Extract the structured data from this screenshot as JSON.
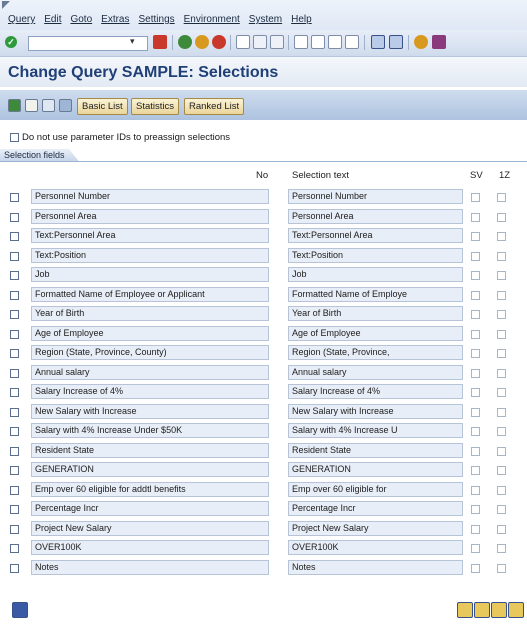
{
  "menu": [
    "Query",
    "Edit",
    "Goto",
    "Extras",
    "Settings",
    "Environment",
    "System",
    "Help"
  ],
  "window_title": "Change Query SAMPLE: Selections",
  "app_toolbar": {
    "basic_list": "Basic List",
    "statistics": "Statistics",
    "ranked_list": "Ranked List"
  },
  "option_label": "Do not use parameter IDs to preassign selections",
  "tab_label": "Selection fields",
  "columns": {
    "no": "No",
    "selection_text": "Selection text",
    "sv": "SV",
    "z1": "1Z"
  },
  "rows": [
    {
      "name": "Personnel Number",
      "text": "Personnel Number"
    },
    {
      "name": "Personnel Area",
      "text": "Personnel Area"
    },
    {
      "name": "Text:Personnel Area",
      "text": "Text:Personnel Area"
    },
    {
      "name": "Text:Position",
      "text": "Text:Position"
    },
    {
      "name": "Job",
      "text": "Job"
    },
    {
      "name": "Formatted Name of Employee or Applicant",
      "text": "Formatted Name of Employe"
    },
    {
      "name": "Year of Birth",
      "text": "Year of Birth"
    },
    {
      "name": "Age of Employee",
      "text": "Age of Employee"
    },
    {
      "name": "Region (State, Province, County)",
      "text": "Region (State, Province,"
    },
    {
      "name": "Annual salary",
      "text": "Annual salary"
    },
    {
      "name": "Salary Increase of 4%",
      "text": "Salary Increase of 4%"
    },
    {
      "name": "New Salary with Increase",
      "text": "New Salary with Increase"
    },
    {
      "name": "Salary with 4% Increase Under $50K",
      "text": "Salary with 4% Increase U"
    },
    {
      "name": "Resident State",
      "text": "Resident State"
    },
    {
      "name": "GENERATION",
      "text": "GENERATION"
    },
    {
      "name": "Emp over 60 eligible for addtl benefits",
      "text": "Emp over 60 eligible for"
    },
    {
      "name": "Percentage Incr",
      "text": "Percentage Incr"
    },
    {
      "name": "Project New Salary",
      "text": "Project New Salary"
    },
    {
      "name": "OVER100K",
      "text": "OVER100K"
    },
    {
      "name": "Notes",
      "text": "Notes"
    }
  ],
  "colors": {
    "title": "#1f3f76",
    "field_bg": "#e8eef7",
    "toolbar_button": "#ead59a",
    "ok_icon": "#2e9a3b"
  },
  "icons": {
    "toolbar": [
      "enter-icon",
      "save-icon",
      "back-icon",
      "exit-icon",
      "cancel-icon",
      "print-icon",
      "find-icon",
      "find-next-icon",
      "first-page-icon",
      "previous-page-icon",
      "next-page-icon",
      "last-page-icon",
      "create-session-icon",
      "shortcut-icon",
      "help-icon",
      "customize-layout-icon"
    ],
    "footer_left": "info-icon",
    "footer_right": [
      "scroll-first-icon",
      "scroll-up-icon",
      "scroll-down-icon",
      "scroll-last-icon"
    ]
  }
}
